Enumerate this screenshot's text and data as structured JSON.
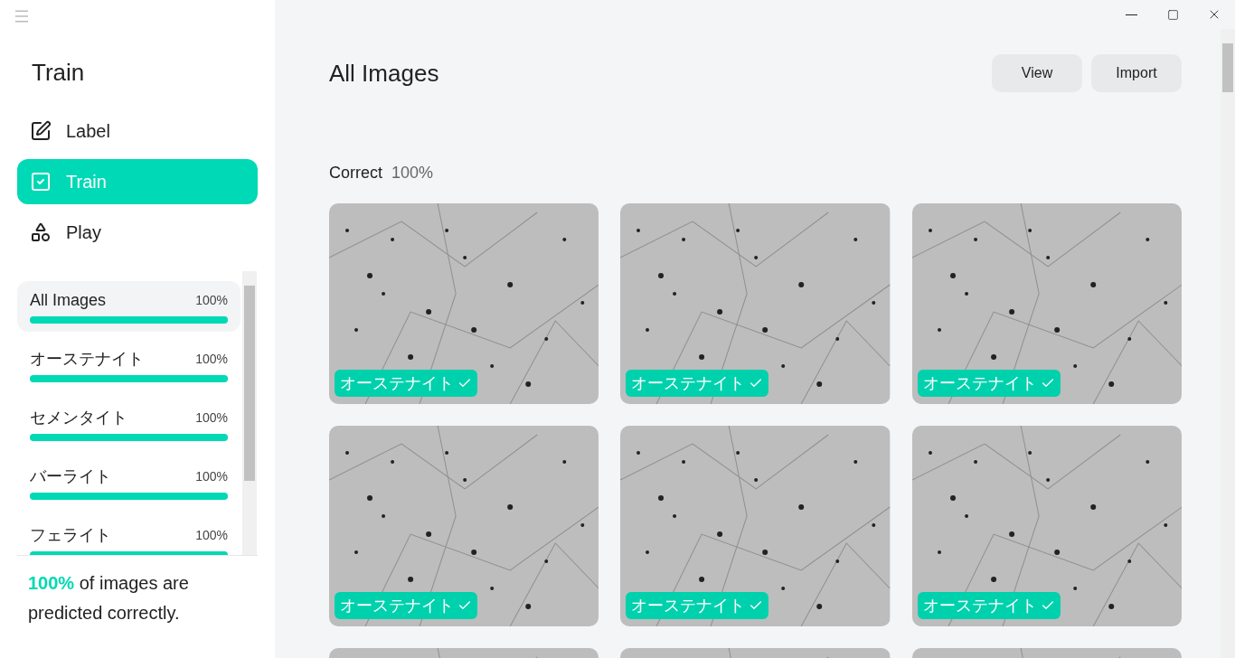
{
  "sidebar": {
    "title": "Train",
    "nav": [
      {
        "label": "Label",
        "kind": "label",
        "selected": false
      },
      {
        "label": "Train",
        "kind": "train",
        "selected": true
      },
      {
        "label": "Play",
        "kind": "play",
        "selected": false
      }
    ],
    "categories": [
      {
        "name": "All Images",
        "percent": "100%",
        "level": 1,
        "selected": true
      },
      {
        "name": "オーステナイト",
        "percent": "100%",
        "level": 1,
        "selected": false
      },
      {
        "name": "セメンタイト",
        "percent": "100%",
        "level": 1,
        "selected": false
      },
      {
        "name": "バーライト",
        "percent": "100%",
        "level": 1,
        "selected": false
      },
      {
        "name": "フェライト",
        "percent": "100%",
        "level": 1,
        "selected": false
      }
    ],
    "summary": {
      "highlight": "100%",
      "text": "of images are predicted correctly."
    }
  },
  "main": {
    "title": "All Images",
    "buttons": [
      "View",
      "Import"
    ],
    "section": {
      "label": "Correct",
      "percent": "100%"
    },
    "images": [
      {
        "kind": "photo",
        "label": "オーステナイト",
        "correct": true
      },
      {
        "kind": "photo",
        "label": "オーステナイト",
        "correct": true
      },
      {
        "kind": "photo",
        "label": "オーステナイト",
        "correct": true
      },
      {
        "kind": "photo",
        "label": "オーステナイト",
        "correct": true
      },
      {
        "kind": "photo",
        "label": "オーステナイト",
        "correct": true
      },
      {
        "kind": "photo",
        "label": "オーステナイト",
        "correct": true
      },
      {
        "kind": "photo"
      },
      {
        "kind": "photo"
      },
      {
        "kind": "photo"
      }
    ]
  }
}
